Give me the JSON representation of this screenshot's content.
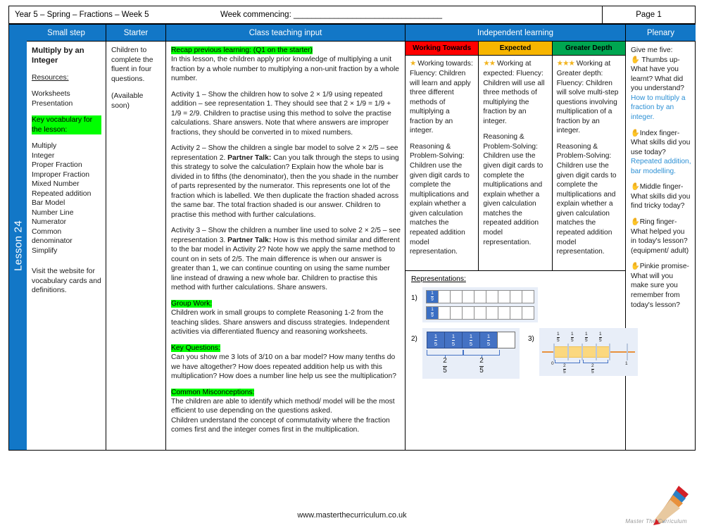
{
  "meta": {
    "left": "Year 5 – Spring – Fractions – Week 5",
    "week_commencing": "Week commencing: _________________________________",
    "page": "Page 1"
  },
  "spine": {
    "label": "Lesson 24",
    "color": "#1277c7"
  },
  "columns": {
    "small_step": "Small step",
    "starter": "Starter",
    "class_teaching_input": "Class teaching input",
    "independent_learning": "Independent learning",
    "plenary": "Plenary"
  },
  "small_step": {
    "title": "Multiply by an Integer",
    "resources_heading": "Resources:",
    "resources": [
      "Worksheets",
      "Presentation"
    ],
    "vocab_heading": "Key vocabulary for the lesson:",
    "vocabulary": [
      "Multiply",
      "Integer",
      "Proper Fraction",
      "Improper Fraction",
      "Mixed Number",
      "Repeated addition",
      "Bar Model",
      "Number Line",
      "Numerator",
      "Common denominator",
      "Simplify"
    ],
    "note": "Visit the website for vocabulary cards and definitions."
  },
  "starter": {
    "text": "Children to complete the fluent in four questions.",
    "availability": "(Available soon)"
  },
  "teaching": {
    "recap_tag": "Recap previous learning: (Q1 on the starter)",
    "recap_text": "In this lesson, the children apply prior knowledge of multiplying a unit fraction by a whole number to multiplying a non-unit fraction by a whole number.",
    "activity1": "Activity 1 – Show the children how to solve 2 × 1/9 using repeated addition – see representation 1. They should see that 2 × 1/9 = 1/9 + 1/9 = 2/9. Children to practise using this method to solve the practise calculations. Share answers. Note that where answers are improper fractions, they should be converted in to mixed numbers.",
    "activity2_pre": "Activity 2 – Show the children a single bar model to solve 2 × 2/5 – see representation 2. ",
    "activity2_bold": "Partner Talk:",
    "activity2_post": " Can you talk through the steps to using this strategy to solve the calculation? Explain how the whole bar is divided in to fifths (the denominator), then the you shade in the number of parts represented by the numerator. This represents one lot of the fraction which is labelled. We then duplicate the fraction shaded across the same bar. The total fraction shaded is our answer. Children to practise this method with further calculations.",
    "activity3_pre": "Activity 3 – Show the children a number line used to solve 2 × 2/5 – see representation 3. ",
    "activity3_bold": "Partner Talk:",
    "activity3_post": " How is this method similar and different to the bar model in Activity 2? Note how we apply the same method to count on in sets of 2/5. The main difference is when our answer is greater than 1, we can continue counting on using the same number line instead of drawing a new whole bar. Children to practise this method with further calculations. Share answers.",
    "group_work_tag": "Group Work:",
    "group_work_text": "Children work in small groups to complete Reasoning 1-2 from the teaching slides. Share answers and discuss strategies. Independent activities via differentiated fluency and reasoning worksheets.",
    "key_questions_tag": "Key Questions:",
    "key_questions_text": "Can you show me 3 lots of 3/10 on a bar model? How many tenths do we have altogether? How does repeated addition help us with this multiplication? How does a number line help us see the multiplication?",
    "misconceptions_tag": "Common Misconceptions:",
    "misconceptions_text1": "The children are able to identify which method/ model will be the most efficient to use depending on the questions asked.",
    "misconceptions_text2": "Children understand the concept of commutativity where the fraction comes first and the integer comes first in the multiplication."
  },
  "independent": {
    "bands": [
      {
        "label": "Working Towards",
        "color": "#ff0000",
        "stars": "★",
        "heading": "Working towards:",
        "fluency": "Fluency: Children will learn and apply three different methods of multiplying a fraction by an integer.",
        "reasoning": "Reasoning & Problem-Solving: Children use the given digit cards to complete the multiplications and explain whether a given calculation matches the repeated addition model representation."
      },
      {
        "label": "Expected",
        "color": "#f7b500",
        "stars": "★★",
        "heading": "Working at expected:",
        "fluency": "Fluency: Children will use all three methods of multiplying the fraction by an integer.",
        "reasoning": "Reasoning & Problem-Solving: Children use the given digit cards to complete the multiplications and explain whether a given calculation matches the repeated addition model representation."
      },
      {
        "label": "Greater Depth",
        "color": "#00a651",
        "stars": "★★★",
        "heading": "Working at Greater depth:",
        "fluency": "Fluency: Children will solve multi-step questions involving multiplication of a fraction by an integer.",
        "reasoning": "Reasoning & Problem-Solving: Children use the given digit cards to complete the multiplications and explain whether a given calculation matches the repeated addition model representation."
      }
    ],
    "representations_title": "Representations:",
    "rep1": {
      "number": "1)",
      "cells": 9,
      "shaded": 1,
      "fraction_num": "1",
      "fraction_den": "9",
      "bars": 2
    },
    "rep2": {
      "number": "2)",
      "cells": 5,
      "shaded": 4,
      "fraction_num": "1",
      "fraction_den": "5",
      "group_labels": [
        {
          "num": "2",
          "den": "5"
        },
        {
          "num": "2",
          "den": "5"
        }
      ]
    },
    "rep3": {
      "number": "3)",
      "start_label": "0",
      "end_label": "1",
      "unit_fractions": [
        {
          "num": "1",
          "den": "5"
        },
        {
          "num": "1",
          "den": "5"
        },
        {
          "num": "1",
          "den": "5"
        },
        {
          "num": "1",
          "den": "5"
        }
      ],
      "group_labels": [
        {
          "num": "2",
          "den": "5"
        },
        {
          "num": "2",
          "den": "5"
        }
      ]
    }
  },
  "plenary": {
    "intro": "Give me five:",
    "items": [
      {
        "hand": "✋",
        "prompt": "Thumbs up- What have you learnt? What did you understand?",
        "answer": "How to multiply a fraction by an integer."
      },
      {
        "hand": "✋",
        "prompt": "Index finger- What skills did you use today?",
        "answer": "Repeated addition, bar modelling."
      },
      {
        "hand": "✋",
        "prompt": "Middle finger- What skills did you find tricky today?",
        "answer": ""
      },
      {
        "hand": "✋",
        "prompt": "Ring finger- What helped you in today's lesson? (equipment/ adult)",
        "answer": ""
      },
      {
        "hand": "✋",
        "prompt": "Pinkie promise- What will you make sure you remember from today's lesson?",
        "answer": ""
      }
    ]
  },
  "footer": {
    "url": "www.masterthecurriculum.co.uk",
    "logo_text": "Master The Curriculum"
  }
}
